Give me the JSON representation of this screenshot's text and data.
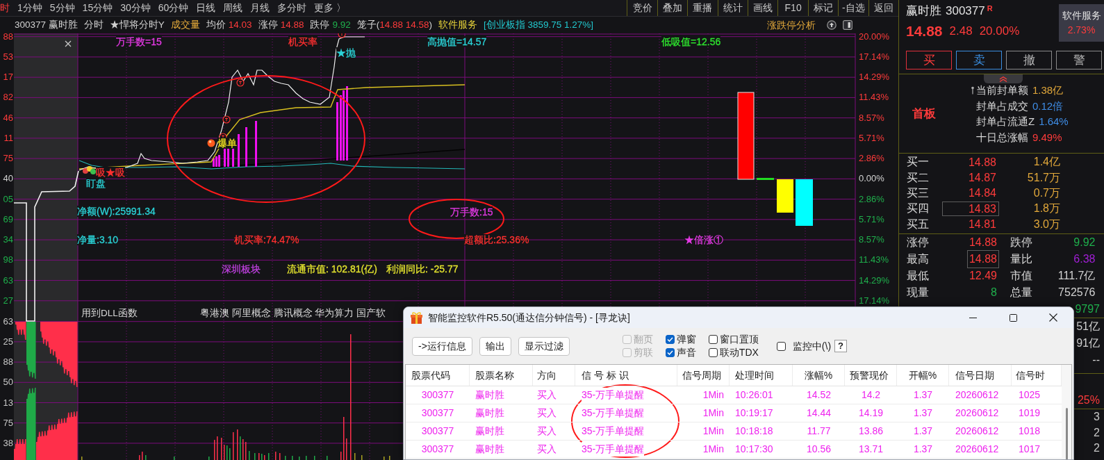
{
  "toolbar": {
    "tabs": [
      {
        "label": "时",
        "selected": true
      },
      {
        "label": "1分钟",
        "selected": false
      },
      {
        "label": "5分钟",
        "selected": false
      },
      {
        "label": "15分钟",
        "selected": false
      },
      {
        "label": "30分钟",
        "selected": false
      },
      {
        "label": "60分钟",
        "selected": false
      },
      {
        "label": "日线",
        "selected": false
      },
      {
        "label": "周线",
        "selected": false
      },
      {
        "label": "月线",
        "selected": false
      },
      {
        "label": "多分时",
        "selected": false
      },
      {
        "label": "更多 〉",
        "selected": false
      }
    ],
    "buttons": [
      "竞价",
      "叠加",
      "重播",
      "统计",
      "画线",
      "F10",
      "标记",
      "-自选",
      "返回"
    ]
  },
  "quote_header": {
    "items": [
      {
        "kind": "pair",
        "parts": [
          {
            "text": "300377 赢时胜",
            "color": "#d2d2d2"
          }
        ]
      },
      {
        "kind": "pair",
        "parts": [
          {
            "text": "分时",
            "color": "#d2d2d2"
          }
        ]
      },
      {
        "kind": "pair",
        "parts": [
          {
            "text": "★悍将分时Y",
            "color": "#d2d2d2"
          }
        ]
      },
      {
        "kind": "pair",
        "parts": [
          {
            "text": "成交量",
            "color": "#e2a83a"
          }
        ]
      },
      {
        "kind": "pair",
        "parts": [
          {
            "text": "均价",
            "color": "#d2d2d2"
          },
          {
            "text": "14.03",
            "color": "#ff3b3b"
          }
        ]
      },
      {
        "kind": "pair",
        "parts": [
          {
            "text": "涨停",
            "color": "#d2d2d2"
          },
          {
            "text": "14.88",
            "color": "#ff3b3b"
          }
        ]
      },
      {
        "kind": "pair",
        "parts": [
          {
            "text": "跌停",
            "color": "#d2d2d2"
          },
          {
            "text": "9.92",
            "color": "#1fb04c"
          }
        ]
      },
      {
        "kind": "tight",
        "parts": [
          {
            "text": "笼子(",
            "color": "#d2d2d2"
          },
          {
            "text": "14.88 14.58",
            "color": "#ff3b3b"
          },
          {
            "text": ")",
            "color": "#d2d2d2"
          }
        ]
      },
      {
        "kind": "pair",
        "parts": [
          {
            "text": "软件服务",
            "color": "#e6d23a"
          }
        ]
      },
      {
        "kind": "pair",
        "parts": [
          {
            "text": "[创业板指 3859.75 1.27%]",
            "color": "#22c8cf"
          }
        ]
      }
    ],
    "analysis_link": "涨跌停分析"
  },
  "main_chart": {
    "left_axis_labels": [
      {
        "text": "88",
        "color": "#ff3b3b"
      },
      {
        "text": "53",
        "color": "#ff3b3b"
      },
      {
        "text": "17",
        "color": "#ff3b3b"
      },
      {
        "text": "82",
        "color": "#ff3b3b"
      },
      {
        "text": "46",
        "color": "#ff3b3b"
      },
      {
        "text": "11",
        "color": "#ff3b3b"
      },
      {
        "text": "75",
        "color": "#ff3b3b"
      },
      {
        "text": "40",
        "color": "#d2d2d2"
      },
      {
        "text": "05",
        "color": "#1fb04c"
      },
      {
        "text": "69",
        "color": "#1fb04c"
      },
      {
        "text": "34",
        "color": "#1fb04c"
      },
      {
        "text": "98",
        "color": "#1fb04c"
      },
      {
        "text": "63",
        "color": "#1fb04c"
      },
      {
        "text": "27",
        "color": "#1fb04c"
      }
    ],
    "right_axis_labels": [
      {
        "text": "20.00%",
        "color": "#ff3b3b"
      },
      {
        "text": "17.14%",
        "color": "#ff3b3b"
      },
      {
        "text": "14.29%",
        "color": "#ff3b3b"
      },
      {
        "text": "11.43%",
        "color": "#ff3b3b"
      },
      {
        "text": "8.57%",
        "color": "#ff3b3b"
      },
      {
        "text": "5.71%",
        "color": "#ff3b3b"
      },
      {
        "text": "2.86%",
        "color": "#ff3b3b"
      },
      {
        "text": "0.00%",
        "color": "#d2d2d2"
      },
      {
        "text": "2.86%",
        "color": "#1fb04c"
      },
      {
        "text": "5.71%",
        "color": "#1fb04c"
      },
      {
        "text": "8.57%",
        "color": "#1fb04c"
      },
      {
        "text": "11.43%",
        "color": "#1fb04c"
      },
      {
        "text": "14.29%",
        "color": "#1fb04c"
      },
      {
        "text": "17.14%",
        "color": "#1fb04c"
      }
    ],
    "labels": [
      {
        "text": "万手数=15",
        "color": "#e639e6"
      },
      {
        "text": "机买率",
        "color": "#ff3030"
      },
      {
        "text": "高抛值=14.57",
        "color": "#2ad4d8"
      },
      {
        "text": "低吸值=12.56",
        "color": "#2ee62e"
      },
      {
        "text": "★抛",
        "color": "#2ad4d8"
      },
      {
        "text": "爆单",
        "color": "#f0e020"
      },
      {
        "text": "吸★吸",
        "color": "#ff3030"
      },
      {
        "text": "盯盘",
        "color": "#2ad4d8"
      },
      {
        "text": "净额(W):25991.34",
        "color": "#2ad4d8"
      },
      {
        "text": "万手数:15",
        "color": "#e639e6"
      },
      {
        "text": "净量:3.10",
        "color": "#2ad4d8"
      },
      {
        "text": "机买率:74.47%",
        "color": "#ff3030"
      },
      {
        "text": "超额比:25.36%",
        "color": "#ff3030"
      },
      {
        "text": "★倍涨①",
        "color": "#e639e6"
      },
      {
        "text": "深圳板块",
        "color": "#c040e0"
      },
      {
        "text": "流通市值: 102.81(亿)",
        "color": "#e6e62e"
      },
      {
        "text": "利润同比: -25.77",
        "color": "#e6e62e"
      }
    ]
  },
  "info_row": {
    "function_note": "用到DLL函数",
    "concepts": "粤港澳 阿里概念 腾讯概念 华为算力 国产软"
  },
  "volume_chart": {
    "axis_labels": [
      "63",
      "25",
      "88",
      "50",
      "13",
      "75",
      "38"
    ]
  },
  "quote_panel": {
    "name": "赢时胜",
    "code": "300377",
    "badge": "R",
    "sector": {
      "name": "软件服务",
      "change": "2.73%"
    },
    "price": "14.88",
    "change": "2.48",
    "change_pct": "20.00%",
    "actions": [
      {
        "label": "买",
        "kind": "buy"
      },
      {
        "label": "卖",
        "kind": "sell"
      },
      {
        "label": "撤",
        "kind": "neutral"
      },
      {
        "label": "警",
        "kind": "neutral"
      }
    ],
    "board_tag": "首板",
    "seal_stats": [
      {
        "label": "当前封单额",
        "value": "1.38亿",
        "color": "#e2a83a"
      },
      {
        "label": "封单占成交",
        "value": "0.12倍",
        "color": "#3f8de6"
      },
      {
        "label": "封单占流通Z",
        "value": "1.64%",
        "color": "#3f8de6"
      },
      {
        "label": "十日总涨幅",
        "value": "9.49%",
        "color": "#ff3b3b"
      }
    ],
    "bids": [
      {
        "label": "买一",
        "price": "14.88",
        "volume": "1.4亿",
        "highlighted": false
      },
      {
        "label": "买二",
        "price": "14.87",
        "volume": "51.7万",
        "highlighted": false
      },
      {
        "label": "买三",
        "price": "14.84",
        "volume": "0.7万",
        "highlighted": false
      },
      {
        "label": "买四",
        "price": "14.83",
        "volume": "1.8万",
        "highlighted": true
      },
      {
        "label": "买五",
        "price": "14.81",
        "volume": "3.0万",
        "highlighted": false
      }
    ],
    "stats": [
      {
        "label": "涨停",
        "value": "14.88",
        "color": "#ff3b3b",
        "highlighted": false
      },
      {
        "label": "跌停",
        "value": "9.92",
        "color": "#1fb04c",
        "highlighted": false
      },
      {
        "label": "最高",
        "value": "14.88",
        "color": "#ff3b3b",
        "highlighted": true
      },
      {
        "label": "量比",
        "value": "6.38",
        "color": "#a21fd6",
        "highlighted": false
      },
      {
        "label": "最低",
        "value": "12.49",
        "color": "#ff3b3b",
        "highlighted": false
      },
      {
        "label": "市值",
        "value": "111.7亿",
        "color": "#d2d2d2",
        "highlighted": false
      },
      {
        "label": "现量",
        "value": "8",
        "color": "#1fb04c",
        "highlighted": false
      },
      {
        "label": "总量",
        "value": "752576",
        "color": "#d2d2d2",
        "highlighted": false
      }
    ],
    "more_values": [
      [
        {
          "text": "9797",
          "color": "#1fb04c"
        }
      ],
      [
        {
          "text": "51亿",
          "color": "#d2d2d2"
        },
        {
          "text": "91亿",
          "color": "#d2d2d2"
        },
        {
          "text": "--",
          "color": "#d2d2d2"
        }
      ],
      [
        {
          "text": "25%",
          "color": "#ff3b3b"
        }
      ],
      [
        {
          "text": "3",
          "color": "#c8c8c8"
        },
        {
          "text": "2",
          "color": "#c8c8c8"
        },
        {
          "text": "2",
          "color": "#c8c8c8"
        }
      ]
    ]
  },
  "monitor_window": {
    "title": "智能监控软件R5.50(通达信分钟信号) - [寻龙诀]",
    "buttons": [
      "->运行信息",
      "输出",
      "显示过滤"
    ],
    "options": [
      {
        "label": "翻页",
        "checked": false,
        "disabled": true
      },
      {
        "label": "剪联",
        "checked": false,
        "disabled": true
      },
      {
        "label": "弹窗",
        "checked": true,
        "disabled": false
      },
      {
        "label": "声音",
        "checked": true,
        "disabled": false
      },
      {
        "label": "窗口置顶",
        "checked": false,
        "disabled": false
      },
      {
        "label": "联动TDX",
        "checked": false,
        "disabled": false
      }
    ],
    "monitor_toggle": {
      "label": "监控中(\\)",
      "checked": false
    },
    "help_button": "?",
    "table": {
      "columns": [
        "股票代码",
        "股票名称",
        "方向",
        "信 号 标 识",
        "信号周期",
        "处理时间",
        "涨幅%",
        "预警现价",
        "开幅%",
        "信号日期",
        "信号时"
      ],
      "rows": [
        [
          "300377",
          "赢时胜",
          "买入",
          "35-万手单提醒",
          "1Min",
          "10:26:01",
          "14.52",
          "14.2",
          "1.37",
          "20260612",
          "1025"
        ],
        [
          "300377",
          "赢时胜",
          "买入",
          "35-万手单提醒",
          "1Min",
          "10:19:17",
          "14.44",
          "14.19",
          "1.37",
          "20260612",
          "1019"
        ],
        [
          "300377",
          "赢时胜",
          "买入",
          "35-万手单提醒",
          "1Min",
          "10:18:18",
          "11.77",
          "13.86",
          "1.37",
          "20260612",
          "1018"
        ],
        [
          "300377",
          "赢时胜",
          "买入",
          "35-万手单提醒",
          "1Min",
          "10:17:30",
          "10.56",
          "13.71",
          "1.37",
          "20260612",
          "1017"
        ]
      ]
    }
  }
}
